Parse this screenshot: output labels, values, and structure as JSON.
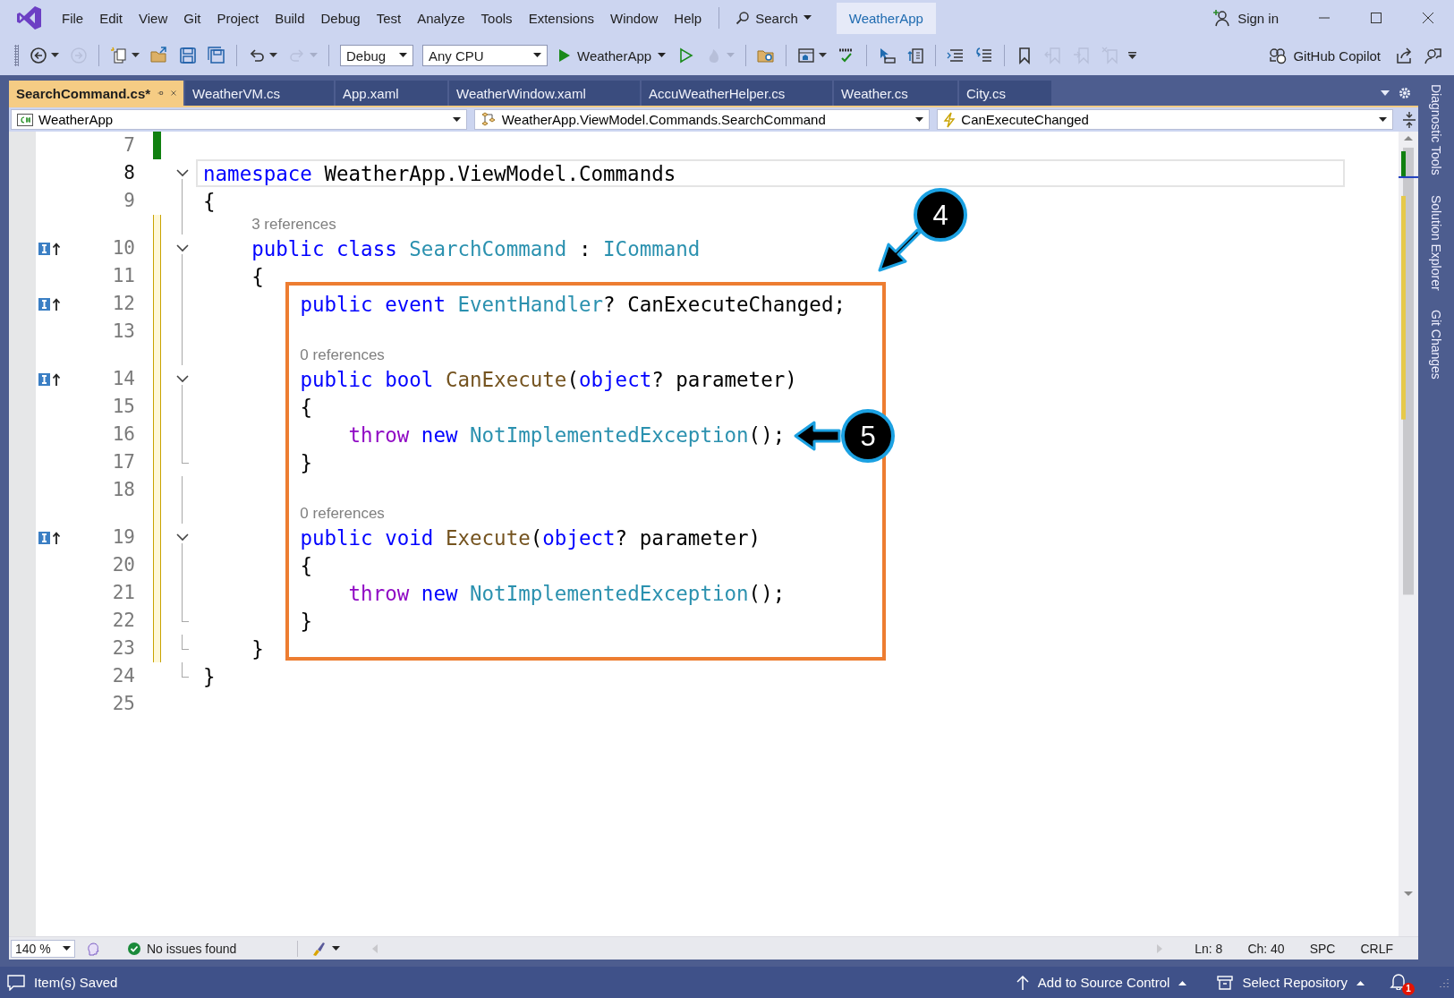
{
  "title_bar": {
    "menu": [
      "File",
      "Edit",
      "View",
      "Git",
      "Project",
      "Build",
      "Debug",
      "Test",
      "Analyze",
      "Tools",
      "Extensions",
      "Window",
      "Help"
    ],
    "search": "Search",
    "solution": "WeatherApp",
    "sign_in": "Sign in"
  },
  "toolbar": {
    "buttons": [
      {
        "disabled": false
      },
      {
        "disabled": true
      },
      {
        "disabled": false
      },
      {
        "disabled": false
      },
      {
        "disabled": false
      },
      {
        "disabled": false
      },
      {
        "disabled": false
      },
      {
        "disabled": true
      },
      {
        "disabled": false
      },
      {
        "disabled": true
      },
      {
        "disabled": false
      },
      {
        "disabled": false
      },
      {
        "disabled": false
      },
      {
        "disabled": false
      },
      {
        "disabled": false
      },
      {
        "disabled": false
      },
      {
        "disabled": false
      },
      {
        "disabled": false
      },
      {
        "disabled": true
      },
      {
        "disabled": true
      },
      {
        "disabled": true
      }
    ],
    "configuration": "Debug",
    "platform": "Any CPU",
    "start": "WeatherApp",
    "copilot": "GitHub Copilot"
  },
  "tabs": [
    {
      "label": "SearchCommand.cs*",
      "selected": true
    },
    {
      "label": "WeatherVM.cs",
      "selected": false
    },
    {
      "label": "App.xaml",
      "selected": false
    },
    {
      "label": "WeatherWindow.xaml",
      "selected": false
    },
    {
      "label": "AccuWeatherHelper.cs",
      "selected": false
    },
    {
      "label": "Weather.cs",
      "selected": false
    },
    {
      "label": "City.cs",
      "selected": false
    }
  ],
  "navigation": {
    "project": "WeatherApp",
    "type": "WeatherApp.ViewModel.Commands.SearchCommand",
    "member": "CanExecuteChanged"
  },
  "editor": {
    "lines": [
      {
        "kind": "code",
        "number": "7",
        "modified": true,
        "saved": true,
        "current": false,
        "implements": false
      },
      {
        "kind": "code",
        "number": "8",
        "modified": false,
        "current": true,
        "implements": false,
        "tokens": [
          {
            "text": "namespace",
            "kind": "keyword"
          },
          {
            "text": " WeatherApp.ViewModel.Commands",
            "kind": "plain"
          }
        ],
        "children": [
          {
            "kind": "code",
            "number": "9",
            "modified": false,
            "current": false,
            "implements": false,
            "tokens": [
              {
                "text": "{",
                "kind": "plain"
              }
            ]
          },
          {
            "kind": "references",
            "text": "3 references",
            "modified": true,
            "saved": false
          },
          {
            "kind": "code",
            "number": "10",
            "modified": true,
            "saved": false,
            "current": false,
            "implements": true,
            "tokens": [
              {
                "text": "    public class ",
                "kind": "keyword"
              },
              {
                "text": "SearchCommand",
                "kind": "type"
              },
              {
                "text": " : ",
                "kind": "plain"
              },
              {
                "text": "ICommand",
                "kind": "type"
              }
            ],
            "children": [
              {
                "kind": "code",
                "number": "11",
                "modified": true,
                "saved": false,
                "current": false,
                "implements": false,
                "tokens": [
                  {
                    "text": "    {",
                    "kind": "plain"
                  }
                ]
              },
              {
                "kind": "code",
                "number": "12",
                "modified": true,
                "saved": false,
                "current": false,
                "implements": true,
                "tokens": [
                  {
                    "text": "        public event ",
                    "kind": "keyword"
                  },
                  {
                    "text": "EventHandler",
                    "kind": "type"
                  },
                  {
                    "text": "? CanExecuteChanged;",
                    "kind": "plain"
                  }
                ]
              },
              {
                "kind": "code",
                "number": "13",
                "modified": true,
                "saved": false,
                "current": false,
                "implements": false
              },
              {
                "kind": "references",
                "text": "0 references",
                "modified": true,
                "saved": false
              },
              {
                "kind": "code",
                "number": "14",
                "modified": true,
                "saved": false,
                "current": false,
                "implements": true,
                "tokens": [
                  {
                    "text": "        public bool ",
                    "kind": "keyword"
                  },
                  {
                    "text": "CanExecute",
                    "kind": "method"
                  },
                  {
                    "text": "(",
                    "kind": "plain"
                  },
                  {
                    "text": "object",
                    "kind": "keyword"
                  },
                  {
                    "text": "? parameter)",
                    "kind": "plain"
                  }
                ],
                "children": [
                  {
                    "kind": "code",
                    "number": "15",
                    "modified": true,
                    "saved": false,
                    "current": false,
                    "implements": false,
                    "tokens": [
                      {
                        "text": "        {",
                        "kind": "plain"
                      }
                    ]
                  },
                  {
                    "kind": "code",
                    "number": "16",
                    "modified": true,
                    "saved": false,
                    "current": false,
                    "implements": false,
                    "tokens": [
                      {
                        "text": "            throw ",
                        "kind": "control"
                      },
                      {
                        "text": "new ",
                        "kind": "keyword"
                      },
                      {
                        "text": "NotImplementedException",
                        "kind": "type"
                      },
                      {
                        "text": "();",
                        "kind": "plain"
                      }
                    ]
                  },
                  {
                    "kind": "code",
                    "number": "17",
                    "modified": true,
                    "saved": false,
                    "current": false,
                    "implements": false,
                    "tokens": [
                      {
                        "text": "        }",
                        "kind": "plain"
                      }
                    ]
                  }
                ]
              },
              {
                "kind": "code",
                "number": "18",
                "modified": true,
                "saved": false,
                "current": false,
                "implements": false
              },
              {
                "kind": "references",
                "text": "0 references",
                "modified": true,
                "saved": false
              },
              {
                "kind": "code",
                "number": "19",
                "modified": true,
                "saved": false,
                "current": false,
                "implements": true,
                "tokens": [
                  {
                    "text": "        public void ",
                    "kind": "keyword"
                  },
                  {
                    "text": "Execute",
                    "kind": "method"
                  },
                  {
                    "text": "(",
                    "kind": "plain"
                  },
                  {
                    "text": "object",
                    "kind": "keyword"
                  },
                  {
                    "text": "? parameter)",
                    "kind": "plain"
                  }
                ],
                "children": [
                  {
                    "kind": "code",
                    "number": "20",
                    "modified": true,
                    "saved": false,
                    "current": false,
                    "implements": false,
                    "tokens": [
                      {
                        "text": "        {",
                        "kind": "plain"
                      }
                    ]
                  },
                  {
                    "kind": "code",
                    "number": "21",
                    "modified": true,
                    "saved": false,
                    "current": false,
                    "implements": false,
                    "tokens": [
                      {
                        "text": "            throw ",
                        "kind": "control"
                      },
                      {
                        "text": "new ",
                        "kind": "keyword"
                      },
                      {
                        "text": "NotImplementedException",
                        "kind": "type"
                      },
                      {
                        "text": "();",
                        "kind": "plain"
                      }
                    ]
                  },
                  {
                    "kind": "code",
                    "number": "22",
                    "modified": true,
                    "saved": false,
                    "current": false,
                    "implements": false,
                    "tokens": [
                      {
                        "text": "        }",
                        "kind": "plain"
                      }
                    ]
                  }
                ]
              },
              {
                "kind": "code",
                "number": "23",
                "modified": true,
                "saved": false,
                "current": false,
                "implements": false,
                "tokens": [
                  {
                    "text": "    }",
                    "kind": "plain"
                  }
                ]
              }
            ]
          },
          {
            "kind": "code",
            "number": "24",
            "modified": false,
            "current": false,
            "implements": false,
            "tokens": [
              {
                "text": "}",
                "kind": "plain"
              }
            ]
          }
        ]
      },
      {
        "kind": "code",
        "number": "25",
        "modified": false,
        "current": false,
        "implements": false
      }
    ]
  },
  "annotations": [
    {
      "label": "4"
    },
    {
      "label": "5"
    }
  ],
  "editor_status": {
    "zoom": "140 %",
    "issues": "No issues found",
    "line": "Ln: 8",
    "column": "Ch: 40",
    "whitespace": "SPC",
    "line_ending": "CRLF"
  },
  "side_tabs": [
    "Diagnostic Tools",
    "Solution Explorer",
    "Git Changes"
  ],
  "status_bar": {
    "message": "Item(s) Saved",
    "source_control": "Add to Source Control",
    "repository": "Select Repository",
    "notifications": "1"
  }
}
